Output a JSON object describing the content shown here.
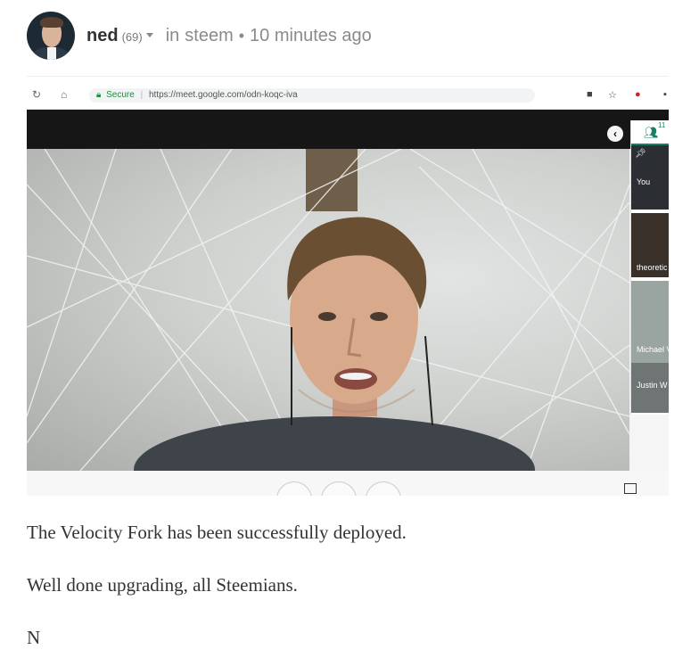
{
  "post": {
    "author": "ned",
    "reputation": "(69)",
    "in_label": "in",
    "community": "steem",
    "separator": "•",
    "time": "10 minutes ago"
  },
  "screenshot": {
    "browser": {
      "secure_label": "Secure",
      "url": "https://meet.google.com/odn-koqc-iva"
    },
    "participants": {
      "count": "11",
      "tiles": [
        {
          "label": "You"
        },
        {
          "label": "theoretic"
        },
        {
          "label": "Michael V"
        },
        {
          "label": "Justin W"
        }
      ]
    }
  },
  "body": {
    "paragraphs": [
      "The Velocity Fork has been successfully deployed.",
      "Well done upgrading, all Steemians.",
      "N"
    ]
  },
  "colors": {
    "accent": "#1a7f68",
    "meet_bar": "#161616",
    "text": "#333333"
  }
}
